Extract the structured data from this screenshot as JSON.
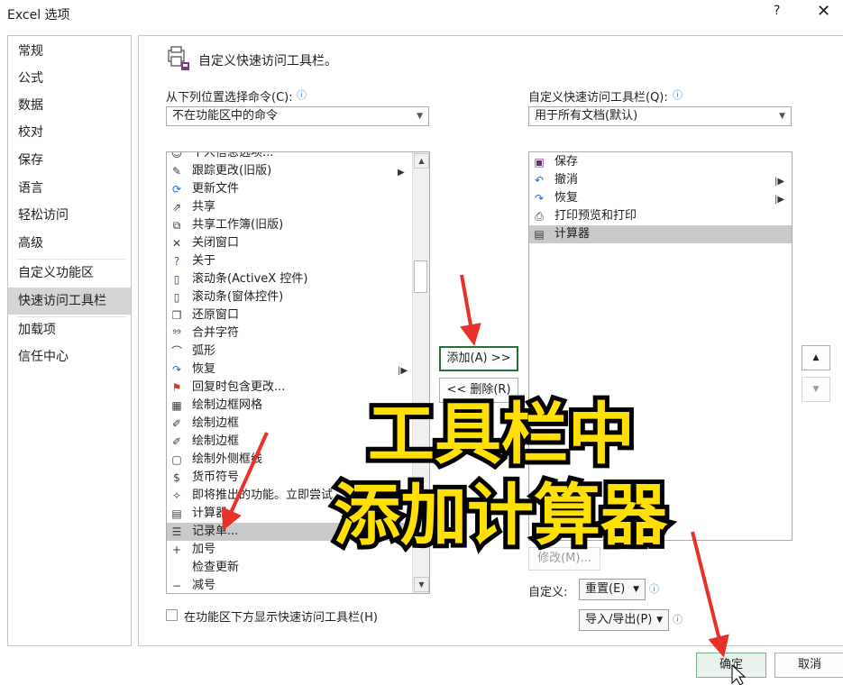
{
  "window": {
    "title": "Excel 选项",
    "help_label": "?",
    "close_label": "✕"
  },
  "sidebar": {
    "items": [
      {
        "label": "常规"
      },
      {
        "label": "公式"
      },
      {
        "label": "数据"
      },
      {
        "label": "校对"
      },
      {
        "label": "保存"
      },
      {
        "label": "语言"
      },
      {
        "label": "轻松访问"
      },
      {
        "label": "高级"
      },
      {
        "label": "自定义功能区"
      },
      {
        "label": "快速访问工具栏"
      },
      {
        "label": "加载项"
      },
      {
        "label": "信任中心"
      }
    ],
    "selected": "快速访问工具栏"
  },
  "main": {
    "title": "自定义快速访问工具栏。",
    "choose_label": "从下列位置选择命令(C):",
    "choose_value": "不在功能区中的命令",
    "customize_label": "自定义快速访问工具栏(Q):",
    "customize_value": "用于所有文档(默认)",
    "commands": [
      {
        "label": "个人信息选项...",
        "icon": "person-icon"
      },
      {
        "label": "跟踪更改(旧版)",
        "icon": "track-changes-icon",
        "submenu": true
      },
      {
        "label": "更新文件",
        "icon": "update-file-icon"
      },
      {
        "label": "共享",
        "icon": "share-icon"
      },
      {
        "label": "共享工作簿(旧版)",
        "icon": "share-workbook-icon"
      },
      {
        "label": "关闭窗口",
        "icon": "close-window-icon"
      },
      {
        "label": "关于",
        "icon": "about-icon"
      },
      {
        "label": "滚动条(ActiveX 控件)",
        "icon": "scrollbar-activex-icon"
      },
      {
        "label": "滚动条(窗体控件)",
        "icon": "scrollbar-form-icon"
      },
      {
        "label": "还原窗口",
        "icon": "restore-window-icon"
      },
      {
        "label": "合并字符",
        "icon": "combine-chars-icon"
      },
      {
        "label": "弧形",
        "icon": "arc-icon"
      },
      {
        "label": "恢复",
        "icon": "redo-icon",
        "submenu": true
      },
      {
        "label": "回复时包含更改...",
        "icon": "reply-changes-icon"
      },
      {
        "label": "绘制边框网格",
        "icon": "draw-border-grid-icon"
      },
      {
        "label": "绘制边框",
        "icon": "draw-border-icon"
      },
      {
        "label": "绘制边框",
        "icon": "draw-border-icon"
      },
      {
        "label": "绘制外侧框线",
        "icon": "draw-outer-border-icon"
      },
      {
        "label": "货币符号",
        "icon": "currency-icon"
      },
      {
        "label": "即将推出的功能。立即尝试",
        "icon": "coming-soon-icon"
      },
      {
        "label": "计算器",
        "icon": "calculator-icon"
      },
      {
        "label": "记录单...",
        "icon": "form-icon",
        "selected": true
      },
      {
        "label": "加号",
        "icon": "plus-icon"
      },
      {
        "label": "检查更新",
        "icon": "check-update-icon"
      },
      {
        "label": "减号",
        "icon": "minus-icon"
      }
    ],
    "qat_items": [
      {
        "label": "保存",
        "icon": "save-icon"
      },
      {
        "label": "撤消",
        "icon": "undo-icon",
        "submenu": true
      },
      {
        "label": "恢复",
        "icon": "redo-icon",
        "submenu": true
      },
      {
        "label": "打印预览和打印",
        "icon": "print-preview-icon"
      },
      {
        "label": "计算器",
        "icon": "calculator-icon",
        "selected": true
      }
    ],
    "add_label": "添加(A) >>",
    "remove_label": "<< 删除(R)",
    "modify_label": "修改(M)...",
    "customize_text": "自定义:",
    "reset_label": "重置(E)",
    "import_export_label": "导入/导出(P)",
    "show_below_label": "在功能区下方显示快速访问工具栏(H)",
    "ok_label": "确定",
    "cancel_label": "取消"
  },
  "overlay": {
    "line1": "工具栏中",
    "line2": "添加计算器"
  },
  "colors": {
    "overlay_text": "#ffe000",
    "arrow": "#e8312a",
    "selection": "#c9c9c9",
    "focus_border": "#2a6d3c"
  }
}
